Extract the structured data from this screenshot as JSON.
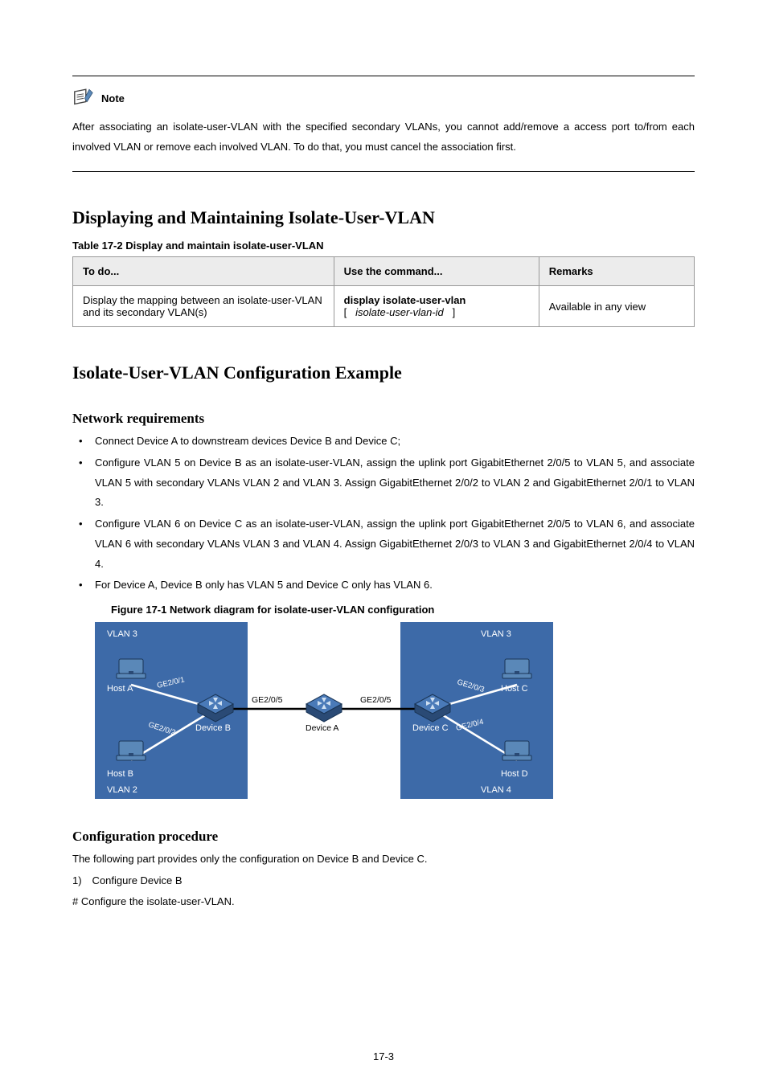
{
  "note": {
    "label": "Note",
    "text": "After associating an isolate-user-VLAN with the specified secondary VLANs, you cannot add/remove a access port to/from each involved VLAN or remove each involved VLAN. To do that, you must cancel the association first."
  },
  "display_section": {
    "heading": "Displaying and Maintaining Isolate-User-VLAN",
    "table_title": "Table 17-2 Display and maintain isolate-user-VLAN",
    "headers": {
      "todo": "To do...",
      "cmd": "Use the command...",
      "remarks": "Remarks"
    },
    "row": {
      "desc": "Display the mapping between an isolate-user-VLAN and its secondary VLAN(s)",
      "cmd_bold1": "display isolate-user-vlan",
      "cmd_open": "[",
      "cmd_arg": "isolate-user-vlan-id",
      "cmd_close": "]",
      "remarks": "Available in any view"
    }
  },
  "example_heading": "Isolate-User-VLAN Configuration Example",
  "net_req": "Network requirements",
  "bullets": [
    "Connect Device A to downstream devices Device B and Device C;",
    "Configure VLAN 5 on Device B as an isolate-user-VLAN, assign the uplink port GigabitEthernet 2/0/5 to VLAN 5, and associate VLAN 5 with secondary VLANs VLAN 2 and VLAN 3. Assign GigabitEthernet 2/0/2 to VLAN 2 and GigabitEthernet 2/0/1 to VLAN 3.",
    "Configure VLAN 6 on Device C as an isolate-user-VLAN, assign the uplink port GigabitEthernet 2/0/5 to VLAN 6, and associate VLAN 6 with secondary VLANs VLAN 3 and VLAN 4. Assign GigabitEthernet 2/0/3 to VLAN 3 and GigabitEthernet 2/0/4 to VLAN 4.",
    "For Device A, Device B only has VLAN 5 and Device C only has VLAN 6."
  ],
  "fig_title": "Figure 17-1 Network diagram for isolate-user-VLAN configuration",
  "diagram": {
    "vlan3_l": "VLAN 3",
    "vlan3_r": "VLAN 3",
    "vlan2": "VLAN 2",
    "vlan4": "VLAN 4",
    "host_a": "Host A",
    "host_b": "Host B",
    "host_c": "Host C",
    "host_d": "Host D",
    "dev_a": "Device A",
    "dev_b": "Device B",
    "dev_c": "Device C",
    "ge201": "GE2/0/1",
    "ge202": "GE2/0/2",
    "ge203": "GE2/0/3",
    "ge204": "GE2/0/4",
    "ge205_l": "GE2/0/5",
    "ge205_r": "GE2/0/5"
  },
  "conf_proc": "Configuration procedure",
  "conf_intro": "The following part provides only the configuration on Device B and Device C.",
  "step1": "1) Configure Device B",
  "hash1": "# Configure the isolate-user-VLAN.",
  "pagenum": "17-3"
}
